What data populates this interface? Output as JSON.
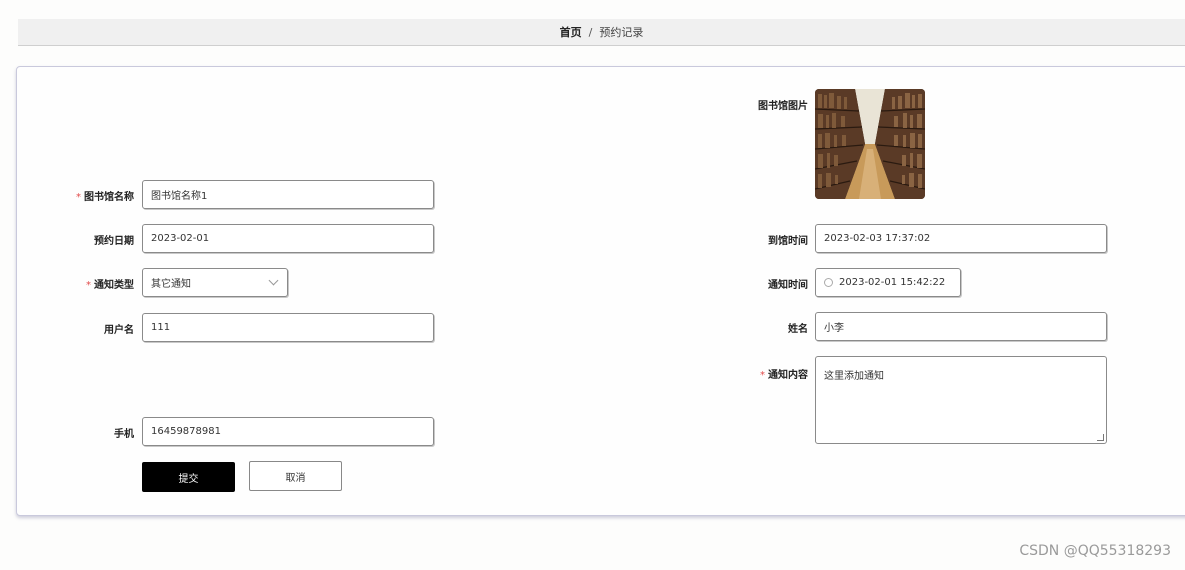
{
  "breadcrumb": {
    "home": "首页",
    "separator": "/",
    "current": "预约记录"
  },
  "form": {
    "library_name": {
      "label": "图书馆名称",
      "value": "图书馆名称1",
      "required": "*"
    },
    "reserve_date": {
      "label": "预约日期",
      "value": "2023-02-01"
    },
    "notify_type": {
      "label": "通知类型",
      "value": "其它通知",
      "required": "*"
    },
    "username": {
      "label": "用户名",
      "value": "111"
    },
    "phone": {
      "label": "手机",
      "value": "16459878981"
    },
    "library_image": {
      "label": "图书馆图片",
      "image_alt": "library bookshelves photo"
    },
    "arrival_time": {
      "label": "到馆时间",
      "value": "2023-02-03 17:37:02"
    },
    "notify_time": {
      "label": "通知时间",
      "value": "2023-02-01 15:42:22",
      "icon": "clock-icon"
    },
    "name": {
      "label": "姓名",
      "value": "小李"
    },
    "notify_content": {
      "label": "通知内容",
      "value": "这里添加通知",
      "required": "*"
    }
  },
  "buttons": {
    "submit": "提交",
    "cancel": "取消"
  },
  "watermark": "CSDN @QQ55318293",
  "colors": {
    "primary_button": "#000000",
    "required_star": "#e24a4a",
    "card_border": "#c9c9dc"
  }
}
